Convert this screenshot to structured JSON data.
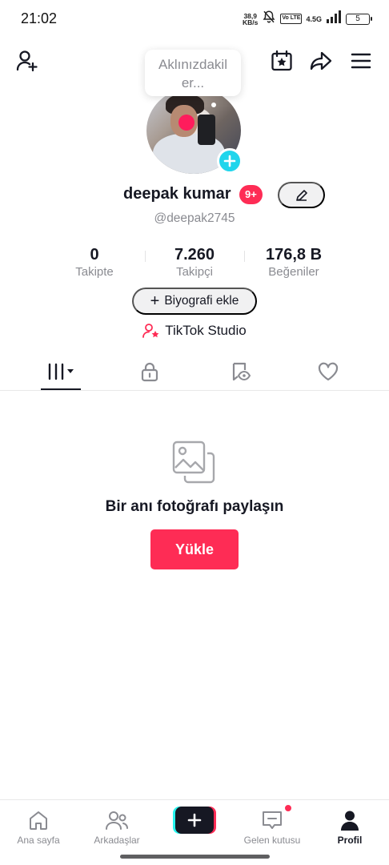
{
  "status_bar": {
    "time": "21:02",
    "net_speed_value": "38,9",
    "net_speed_unit": "KB/s",
    "volte_label": "Vo LTE",
    "network_label": "4.5G",
    "battery_level": "5"
  },
  "top_bar": {
    "icons": [
      "add-friend-icon",
      "calendar-star-icon",
      "share-icon",
      "menu-icon"
    ]
  },
  "profile": {
    "thought_bubble_line1": "Aklınızdakil",
    "thought_bubble_line2": "er...",
    "name": "deepak kumar",
    "notification_badge": "9+",
    "username": "@deepak2745"
  },
  "stats": [
    {
      "value": "0",
      "label": "Takipte"
    },
    {
      "value": "7.260",
      "label": "Takipçi"
    },
    {
      "value": "176,8 B",
      "label": "Beğeniler"
    }
  ],
  "bio_button": {
    "plus": "+",
    "label": "Biyografi ekle"
  },
  "studio_link": {
    "label": "TikTok Studio"
  },
  "tabs": [
    {
      "name": "videos",
      "icon": "grid-icon",
      "active": true
    },
    {
      "name": "private",
      "icon": "lock-icon",
      "active": false
    },
    {
      "name": "reposts",
      "icon": "bookmark-eye-icon",
      "active": false
    },
    {
      "name": "liked",
      "icon": "heart-icon",
      "active": false
    }
  ],
  "empty_state": {
    "icon": "photo-stack-icon",
    "title": "Bir anı fotoğrafı paylaşın",
    "button_label": "Yükle"
  },
  "bottom_nav": {
    "items": [
      {
        "label": "Ana sayfa",
        "icon": "home-icon"
      },
      {
        "label": "Arkadaşlar",
        "icon": "friends-icon"
      },
      {
        "label": "",
        "icon": "plus-icon"
      },
      {
        "label": "Gelen kutusu",
        "icon": "inbox-icon"
      },
      {
        "label": "Profil",
        "icon": "profile-icon"
      }
    ]
  },
  "colors": {
    "accent": "#fe2c55",
    "cyan": "#20d5ec",
    "text_primary": "#161823",
    "text_secondary": "#8a8b91"
  }
}
